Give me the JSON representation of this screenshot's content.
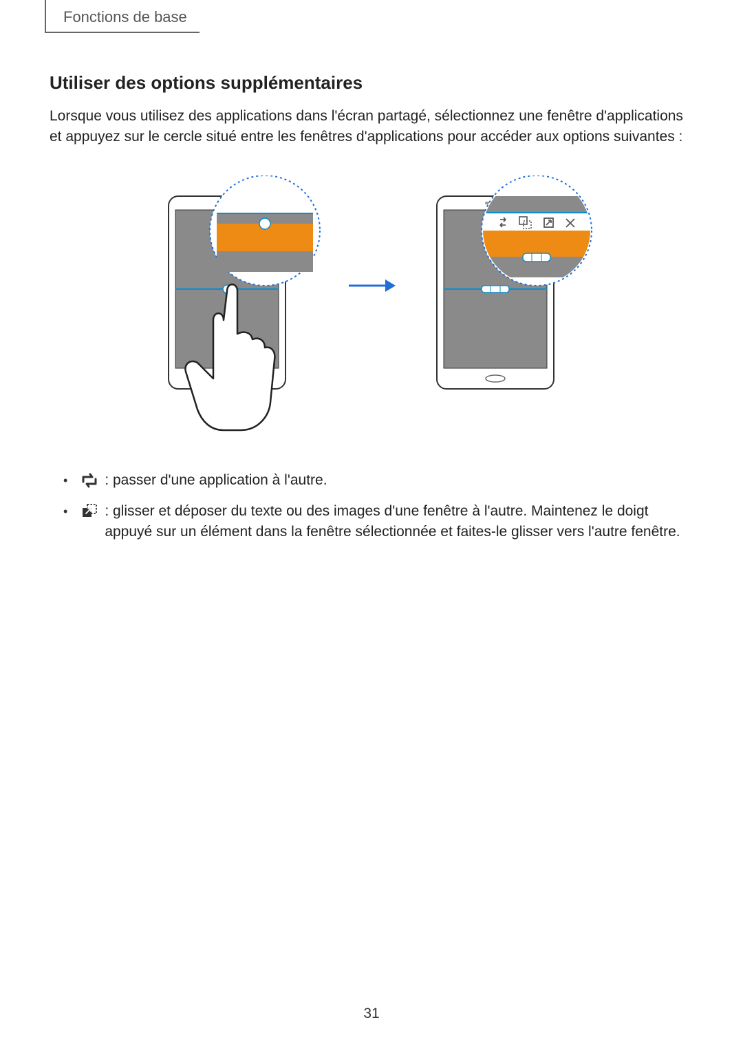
{
  "header": {
    "section": "Fonctions de base"
  },
  "heading": "Utiliser des options supplémentaires",
  "intro": "Lorsque vous utilisez des applications dans l'écran partagé, sélectionnez une fenêtre d'applications et appuyez sur le cercle situé entre les fenêtres d'applications pour accéder aux options suivantes :",
  "bullets": [
    {
      "icon": "swap-icon",
      "text": " : passer d'une application à l'autre."
    },
    {
      "icon": "drag-drop-icon",
      "text": " : glisser et déposer du texte ou des images d'une fenêtre à l'autre. Maintenez le doigt appuyé sur un élément dans la fenêtre sélectionnée et faites-le glisser vers l'autre fenêtre."
    }
  ],
  "page_number": "31",
  "figure": {
    "phone1_alt": "Phone with finger tapping split-screen handle",
    "phone2_alt": "Phone showing expanded split-screen toolbar icons",
    "toolbar_icons": [
      "swap",
      "drag-drop",
      "expand",
      "close"
    ]
  }
}
